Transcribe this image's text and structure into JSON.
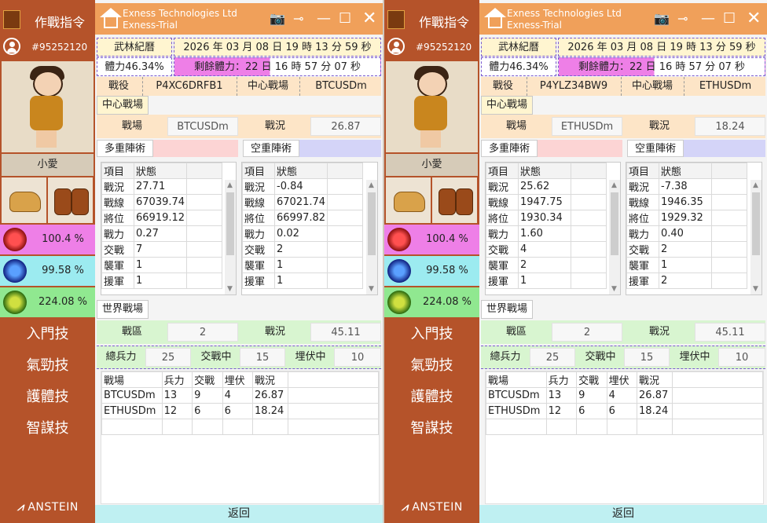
{
  "windows": [
    {
      "sidebar": {
        "title": "作戰指令",
        "account": "#95252120",
        "character_name": "小愛",
        "stats": [
          "100.4 %",
          "99.58 %",
          "224.08 %"
        ],
        "menu": [
          "入門技",
          "氣勁技",
          "護體技",
          "智謀技"
        ],
        "brand": "ANSTEIN"
      },
      "titlebar": {
        "line1": "Exness Technologies Ltd",
        "line2": "Exness-Trial"
      },
      "header": {
        "calendar_label": "武林紀曆",
        "datetime": "2026 年 03 月 08 日 19 時 13 分 59 秒",
        "hp": "體力46.34%",
        "remaining": "剩餘體力：22 日 16 時 57 分 07 秒"
      },
      "battle": {
        "label": "戰役",
        "id": "P4XC6DRFB1",
        "center_label": "中心戰場",
        "symbol": "BTCUSDm"
      },
      "center": {
        "tab": "中心戰場",
        "field_label": "戰場",
        "field_value": "BTCUSDm",
        "status_label": "戰況",
        "status_value": "26.87",
        "multi_title": "多重陣術",
        "short_title": "空重陣術",
        "col_item": "項目",
        "col_state": "狀態",
        "multi_rows": [
          [
            "戰況",
            "27.71"
          ],
          [
            "戰線",
            "67039.74"
          ],
          [
            "將位",
            "66919.12"
          ],
          [
            "戰力",
            "0.27"
          ],
          [
            "交戰",
            "7"
          ],
          [
            "襲軍",
            "1"
          ],
          [
            "援軍",
            "1"
          ]
        ],
        "short_rows": [
          [
            "戰況",
            "-0.84"
          ],
          [
            "戰線",
            "67021.74"
          ],
          [
            "將位",
            "66997.82"
          ],
          [
            "戰力",
            "0.02"
          ],
          [
            "交戰",
            "2"
          ],
          [
            "襲軍",
            "1"
          ],
          [
            "援軍",
            "1"
          ]
        ]
      },
      "world": {
        "tab": "世界戰場",
        "region_label": "戰區",
        "region_value": "2",
        "status_label": "戰況",
        "status_value": "45.11",
        "troops_label": "總兵力",
        "troops_value": "25",
        "engage_label": "交戰中",
        "engage_value": "15",
        "ambush_label": "埋伏中",
        "ambush_value": "10",
        "headers": [
          "戰場",
          "兵力",
          "交戰",
          "埋伏",
          "戰況"
        ],
        "rows": [
          [
            "BTCUSDm",
            "13",
            "9",
            "4",
            "26.87"
          ],
          [
            "ETHUSDm",
            "12",
            "6",
            "6",
            "18.24"
          ]
        ]
      },
      "back": "返回"
    },
    {
      "sidebar": {
        "title": "作戰指令",
        "account": "#95252120",
        "character_name": "小愛",
        "stats": [
          "100.4 %",
          "99.58 %",
          "224.08 %"
        ],
        "menu": [
          "入門技",
          "氣勁技",
          "護體技",
          "智謀技"
        ],
        "brand": "ANSTEIN"
      },
      "titlebar": {
        "line1": "Exness Technologies Ltd",
        "line2": "Exness-Trial"
      },
      "header": {
        "calendar_label": "武林紀曆",
        "datetime": "2026 年 03 月 08 日 19 時 13 分 59 秒",
        "hp": "體力46.34%",
        "remaining": "剩餘體力：22 日 16 時 57 分 07 秒"
      },
      "battle": {
        "label": "戰役",
        "id": "P4YLZ34BW9",
        "center_label": "中心戰場",
        "symbol": "ETHUSDm"
      },
      "center": {
        "tab": "中心戰場",
        "field_label": "戰場",
        "field_value": "ETHUSDm",
        "status_label": "戰況",
        "status_value": "18.24",
        "multi_title": "多重陣術",
        "short_title": "空重陣術",
        "col_item": "項目",
        "col_state": "狀態",
        "multi_rows": [
          [
            "戰況",
            "25.62"
          ],
          [
            "戰線",
            "1947.75"
          ],
          [
            "將位",
            "1930.34"
          ],
          [
            "戰力",
            "1.60"
          ],
          [
            "交戰",
            "4"
          ],
          [
            "襲軍",
            "2"
          ],
          [
            "援軍",
            "1"
          ]
        ],
        "short_rows": [
          [
            "戰況",
            "-7.38"
          ],
          [
            "戰線",
            "1946.35"
          ],
          [
            "將位",
            "1929.32"
          ],
          [
            "戰力",
            "0.40"
          ],
          [
            "交戰",
            "2"
          ],
          [
            "襲軍",
            "1"
          ],
          [
            "援軍",
            "2"
          ]
        ]
      },
      "world": {
        "tab": "世界戰場",
        "region_label": "戰區",
        "region_value": "2",
        "status_label": "戰況",
        "status_value": "45.11",
        "troops_label": "總兵力",
        "troops_value": "25",
        "engage_label": "交戰中",
        "engage_value": "15",
        "ambush_label": "埋伏中",
        "ambush_value": "10",
        "headers": [
          "戰場",
          "兵力",
          "交戰",
          "埋伏",
          "戰況"
        ],
        "rows": [
          [
            "BTCUSDm",
            "13",
            "9",
            "4",
            "26.87"
          ],
          [
            "ETHUSDm",
            "12",
            "6",
            "6",
            "18.24"
          ]
        ]
      },
      "back": "返回"
    }
  ],
  "colors": {
    "sidebar": "#b5532a",
    "titlebar": "#f0a05a",
    "peach": "#fde5c7",
    "hp_magenta": "#ee7fe7",
    "mp_cyan": "#9cebf0",
    "xp_green": "#90e890"
  },
  "icons": {
    "home": "home-icon",
    "camera": "camera-icon",
    "pin": "pin-icon",
    "minimize": "minimize-icon",
    "maximize": "maximize-icon",
    "close": "close-icon"
  }
}
